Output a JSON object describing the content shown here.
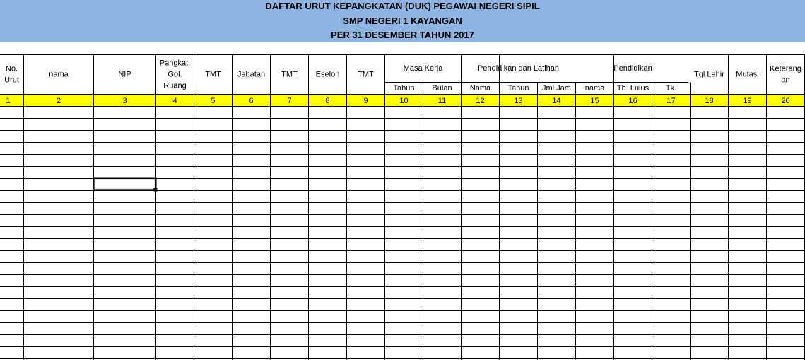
{
  "title": {
    "line1": "DAFTAR URUT KEPANGKATAN (DUK) PEGAWAI NEGERI SIPIL",
    "line2": "SMP NEGERI 1 KAYANGAN",
    "line3": "PER 31 DESEMBER TAHUN 2017"
  },
  "colors": {
    "banner": "#8db4e2",
    "number_row": "#ffff00",
    "grid": "#000000"
  },
  "headers": {
    "no_urut": [
      "No.",
      "Urut"
    ],
    "nama": "nama",
    "nip": "NIP",
    "pangkat": [
      "Pangkat,",
      "Gol.",
      "Ruang"
    ],
    "tmt1": "TMT",
    "jabatan": "Jabatan",
    "tmt2": "TMT",
    "eselon": "Eselon",
    "tmt3": "TMT",
    "masa_kerja": "Masa Kerja",
    "masa_kerja_sub": [
      "Tahun",
      "Bulan"
    ],
    "diklat": "Pendidikan dan Latihan",
    "diklat_sub": [
      "Nama",
      "Tahun",
      "Jml Jam"
    ],
    "pendidikan": "Pendidikan",
    "pendidikan_sub": [
      "nama",
      "Th. Lulus",
      "Tk."
    ],
    "tgl_lahir": "Tgl Lahir",
    "mutasi": "Mutasi",
    "keterangan": [
      "Keterang",
      "an"
    ]
  },
  "column_numbers": [
    "1",
    "2",
    "3",
    "4",
    "5",
    "6",
    "7",
    "8",
    "9",
    "10",
    "11",
    "12",
    "13",
    "14",
    "15",
    "16",
    "17",
    "18",
    "19",
    "20"
  ],
  "selected_cell": {
    "row": 7,
    "column": 3
  }
}
